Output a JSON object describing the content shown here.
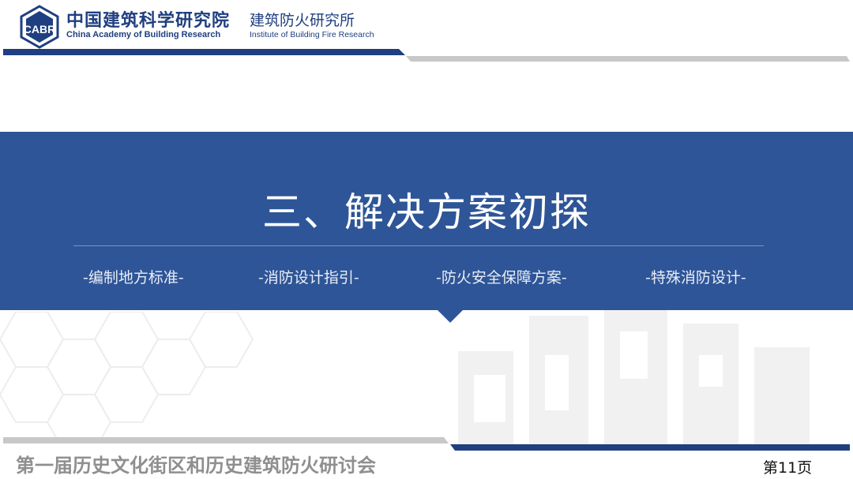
{
  "header": {
    "org_name_cn": "中国建筑科学研究院",
    "org_name_en": "China Academy of Building Research",
    "institute_cn": "建筑防火研究所",
    "institute_en": "Institute of Building Fire Research",
    "logo_icon": "cabr-logo-icon"
  },
  "section": {
    "title": "三、解决方案初探",
    "topics": [
      "-编制地方标准-",
      "-消防设计指引-",
      "-防火安全保障方案-",
      "-特殊消防设计-"
    ]
  },
  "footer": {
    "conference_title": "第一届历史文化街区和历史建筑防火研讨会",
    "page_label": "第11页"
  },
  "colors": {
    "brand_blue": "#2e5597",
    "dark_navy": "#1f3f80",
    "gray_bar": "#c8c8c8",
    "footer_text": "#8f8f8f"
  }
}
